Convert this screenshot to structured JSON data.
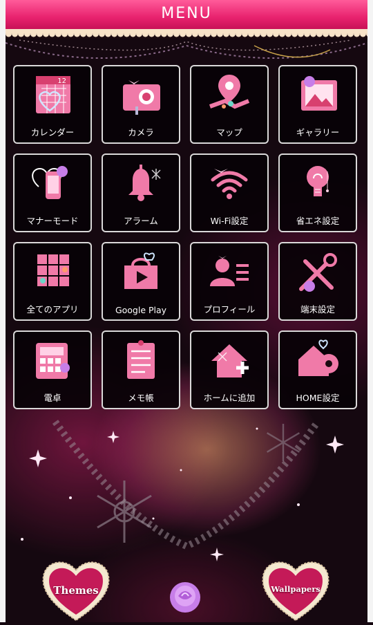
{
  "header": {
    "title": "MENU"
  },
  "apps": [
    {
      "label": "カレンダー",
      "icon": "calendar-heart-icon",
      "date": "12"
    },
    {
      "label": "カメラ",
      "icon": "camera-icon"
    },
    {
      "label": "マップ",
      "icon": "map-pin-icon"
    },
    {
      "label": "ギャラリー",
      "icon": "gallery-icon"
    },
    {
      "label": "マナーモード",
      "icon": "manner-mode-phone-icon"
    },
    {
      "label": "アラーム",
      "icon": "alarm-bell-icon"
    },
    {
      "label": "Wi-Fi設定",
      "icon": "wifi-icon"
    },
    {
      "label": "省エネ設定",
      "icon": "energy-saving-bulb-icon"
    },
    {
      "label": "全てのアプリ",
      "icon": "all-apps-grid-icon"
    },
    {
      "label": "Google Play",
      "icon": "google-play-icon"
    },
    {
      "label": "プロフィール",
      "icon": "profile-icon"
    },
    {
      "label": "端末設定",
      "icon": "device-settings-tools-icon"
    },
    {
      "label": "電卓",
      "icon": "calculator-icon"
    },
    {
      "label": "メモ帳",
      "icon": "memo-pad-icon"
    },
    {
      "label": "ホームに追加",
      "icon": "add-to-home-icon"
    },
    {
      "label": "HOME設定",
      "icon": "home-settings-gear-icon"
    }
  ],
  "bottom": {
    "themes_label": "Themes",
    "wallpapers_label": "Wallpapers",
    "center_icon": "rose-icon"
  },
  "colors": {
    "accent_pink": "#e8226e",
    "icon_pink": "#f07aa8",
    "background": "#150810",
    "lace_cream": "#f8e3c8"
  }
}
